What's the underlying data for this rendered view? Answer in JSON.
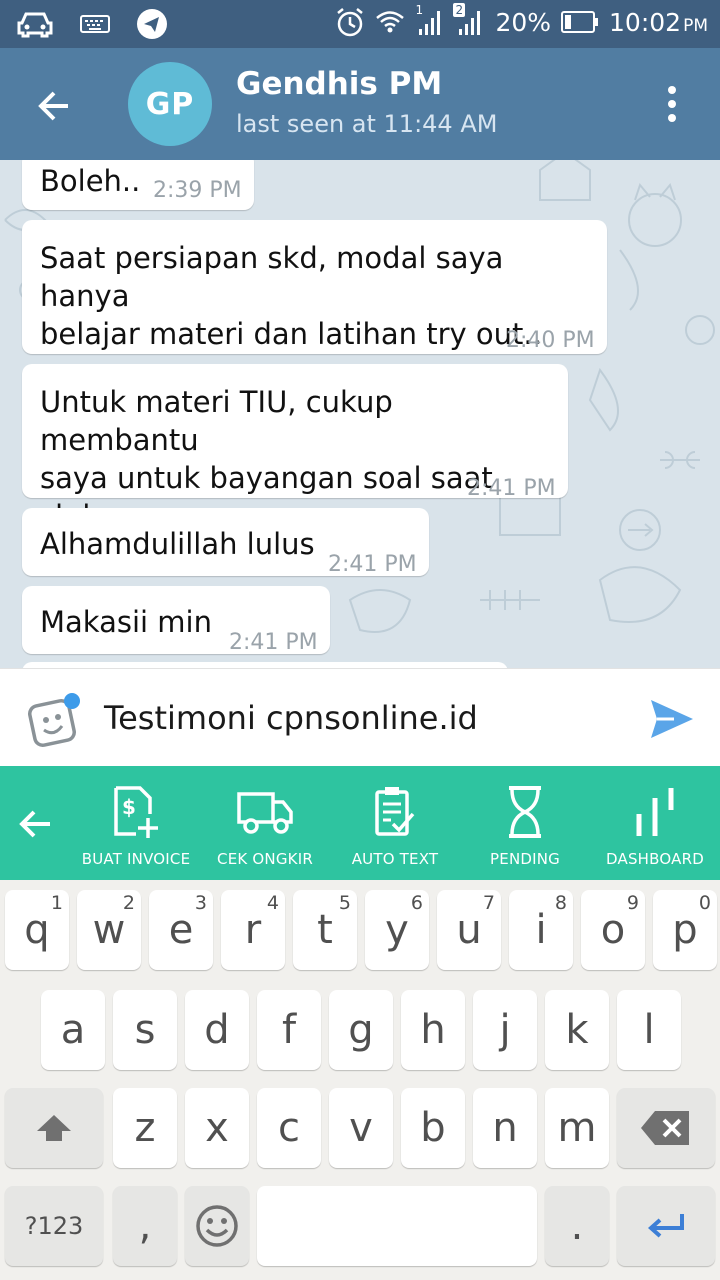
{
  "status_bar": {
    "signal_badge_1": "1",
    "signal_badge_2": "2",
    "battery": "20%",
    "time": "10:02",
    "ampm": "PM"
  },
  "header": {
    "avatar_initials": "GP",
    "avatar_color": "#5fbbd6",
    "contact_name": "Gendhis PM",
    "contact_status": "last seen at 11:44 AM",
    "bar_color": "#517da2"
  },
  "messages": [
    {
      "text": "Boleh..",
      "time": "2:39 PM"
    },
    {
      "text": "Saat persiapan skd, modal saya hanya\nbelajar materi dan latihan try out..",
      "time": "2:40 PM"
    },
    {
      "text": "Untuk materi TIU, cukup membantu\nsaya untuk bayangan soal saat skd",
      "time": "2:41 PM"
    },
    {
      "text": "Alhamdulillah lulus",
      "time": "2:41 PM"
    },
    {
      "text": "Makasii min",
      "time": "2:41 PM"
    }
  ],
  "composer": {
    "value": "Testimoni cpnsonline.id",
    "send_color": "#5aa5e8"
  },
  "toolbar": {
    "color": "#2ec4a0",
    "items": [
      {
        "label": "BUAT INVOICE",
        "icon": "invoice-add-icon"
      },
      {
        "label": "CEK ONGKIR",
        "icon": "truck-icon"
      },
      {
        "label": "AUTO TEXT",
        "icon": "clipboard-check-icon"
      },
      {
        "label": "PENDING",
        "icon": "hourglass-icon"
      },
      {
        "label": "DASHBOARD",
        "icon": "bar-chart-icon"
      }
    ]
  },
  "keyboard": {
    "row1": [
      {
        "key": "q",
        "hint": "1"
      },
      {
        "key": "w",
        "hint": "2"
      },
      {
        "key": "e",
        "hint": "3"
      },
      {
        "key": "r",
        "hint": "4"
      },
      {
        "key": "t",
        "hint": "5"
      },
      {
        "key": "y",
        "hint": "6"
      },
      {
        "key": "u",
        "hint": "7"
      },
      {
        "key": "i",
        "hint": "8"
      },
      {
        "key": "o",
        "hint": "9"
      },
      {
        "key": "p",
        "hint": "0"
      }
    ],
    "row2": [
      "a",
      "s",
      "d",
      "f",
      "g",
      "h",
      "j",
      "k",
      "l"
    ],
    "row3": [
      "z",
      "x",
      "c",
      "v",
      "b",
      "n",
      "m"
    ],
    "symbols_label": "?123",
    "comma": ",",
    "period": "."
  }
}
